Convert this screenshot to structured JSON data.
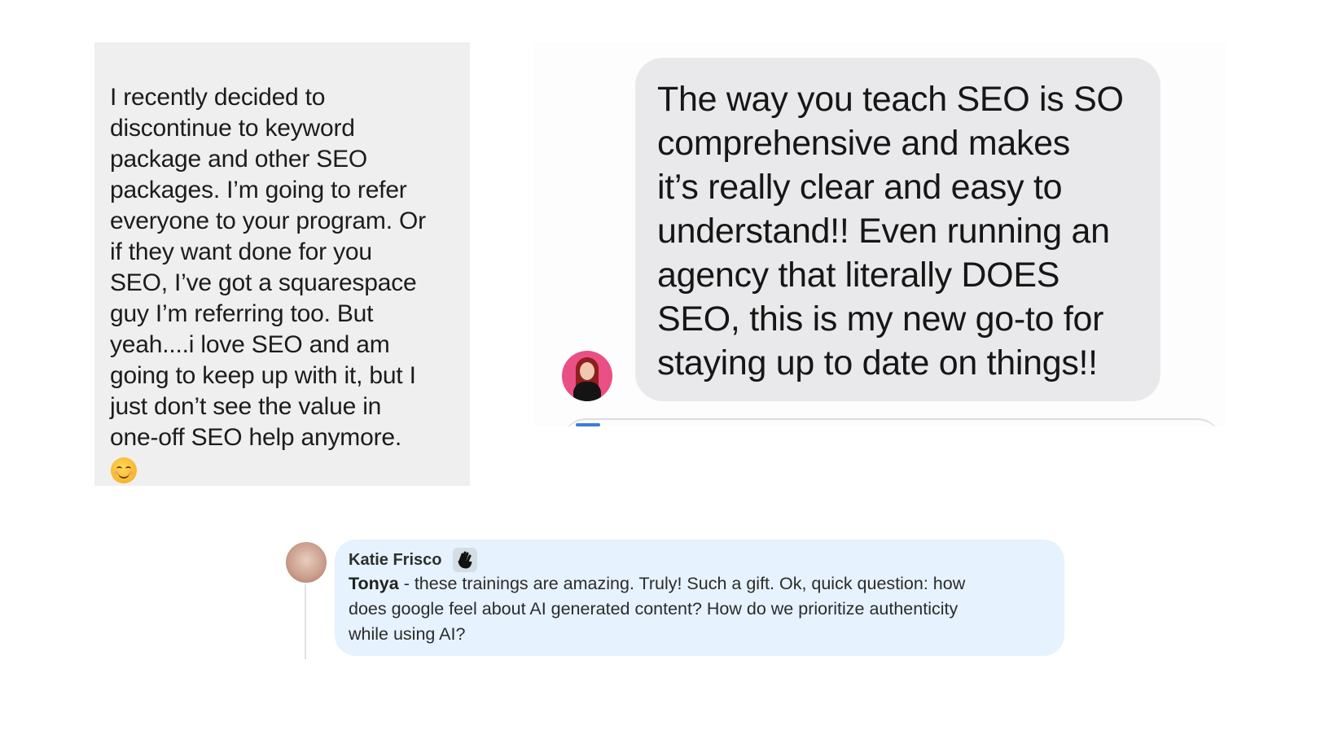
{
  "left_message": {
    "text": "I recently decided to\ndiscontinue to keyword\npackage and other SEO\npackages. I’m going to refer\neveryone to your program. Or\nif they want done for you\nSEO, I’ve got a squarespace\nguy I’m referring too. But\nyeah....i love SEO and am\ngoing to keep up with it, but I\njust don’t see the value in\none-off SEO help anymore.",
    "emoji": "smiling-face-emoji"
  },
  "right_message": {
    "text": "The way you teach SEO is SO\ncomprehensive and makes\nit’s really clear and easy to\nunderstand!! Even running an\nagency that literally DOES\nSEO, this is my new go-to for\nstaying up to date on things!!",
    "avatar": "sender-avatar",
    "colors": {
      "bubble": "#e9e9eb",
      "avatar_bg": "#ea4f86"
    }
  },
  "comment": {
    "author": "Katie Frisco",
    "badge_icon": "waving-hand-icon",
    "mention": "Tonya",
    "text": " - these trainings are amazing. Truly! Such a gift. Ok, quick question: how\ndoes google feel about AI generated content? How do we prioritize authenticity\nwhile using AI?",
    "colors": {
      "bubble": "#e6f2fd"
    }
  }
}
